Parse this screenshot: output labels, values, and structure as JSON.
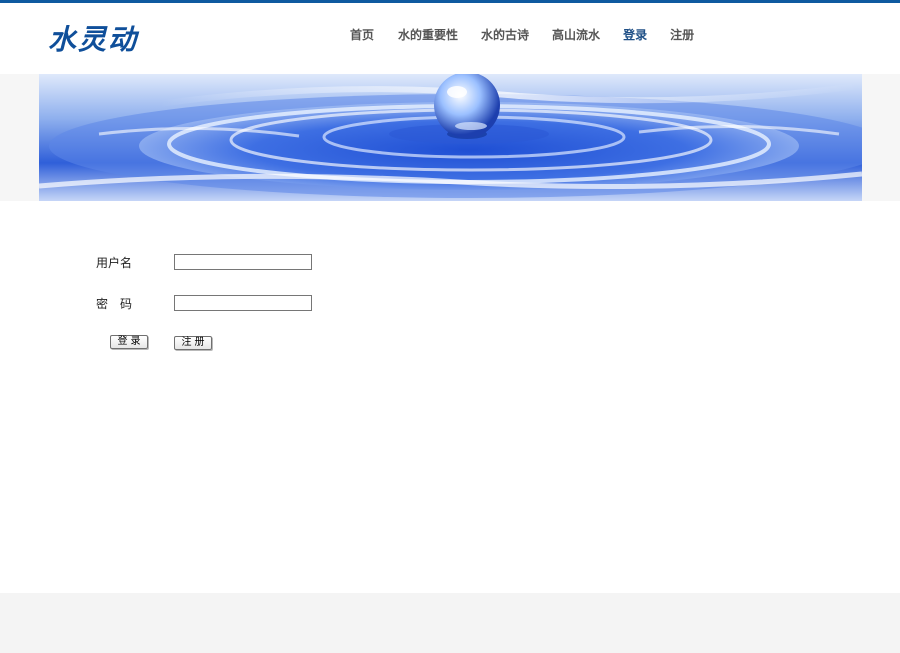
{
  "header": {
    "logo_text": "水灵动",
    "nav": [
      {
        "label": "首页"
      },
      {
        "label": "水的重要性"
      },
      {
        "label": "水的古诗"
      },
      {
        "label": "高山流水"
      },
      {
        "label": "登录",
        "active": true
      },
      {
        "label": "注册"
      }
    ]
  },
  "colors": {
    "accent": "#0f5aa0",
    "nav_text": "#555555",
    "nav_active": "#1e4f86",
    "footer_bg": "#f4f4f4"
  },
  "banner": {
    "image": "water-drop-ripple"
  },
  "form": {
    "username_label": "用户名",
    "username_value": "",
    "password_label": "密　码",
    "password_value": "",
    "login_button": "登录",
    "register_button": "注册"
  }
}
